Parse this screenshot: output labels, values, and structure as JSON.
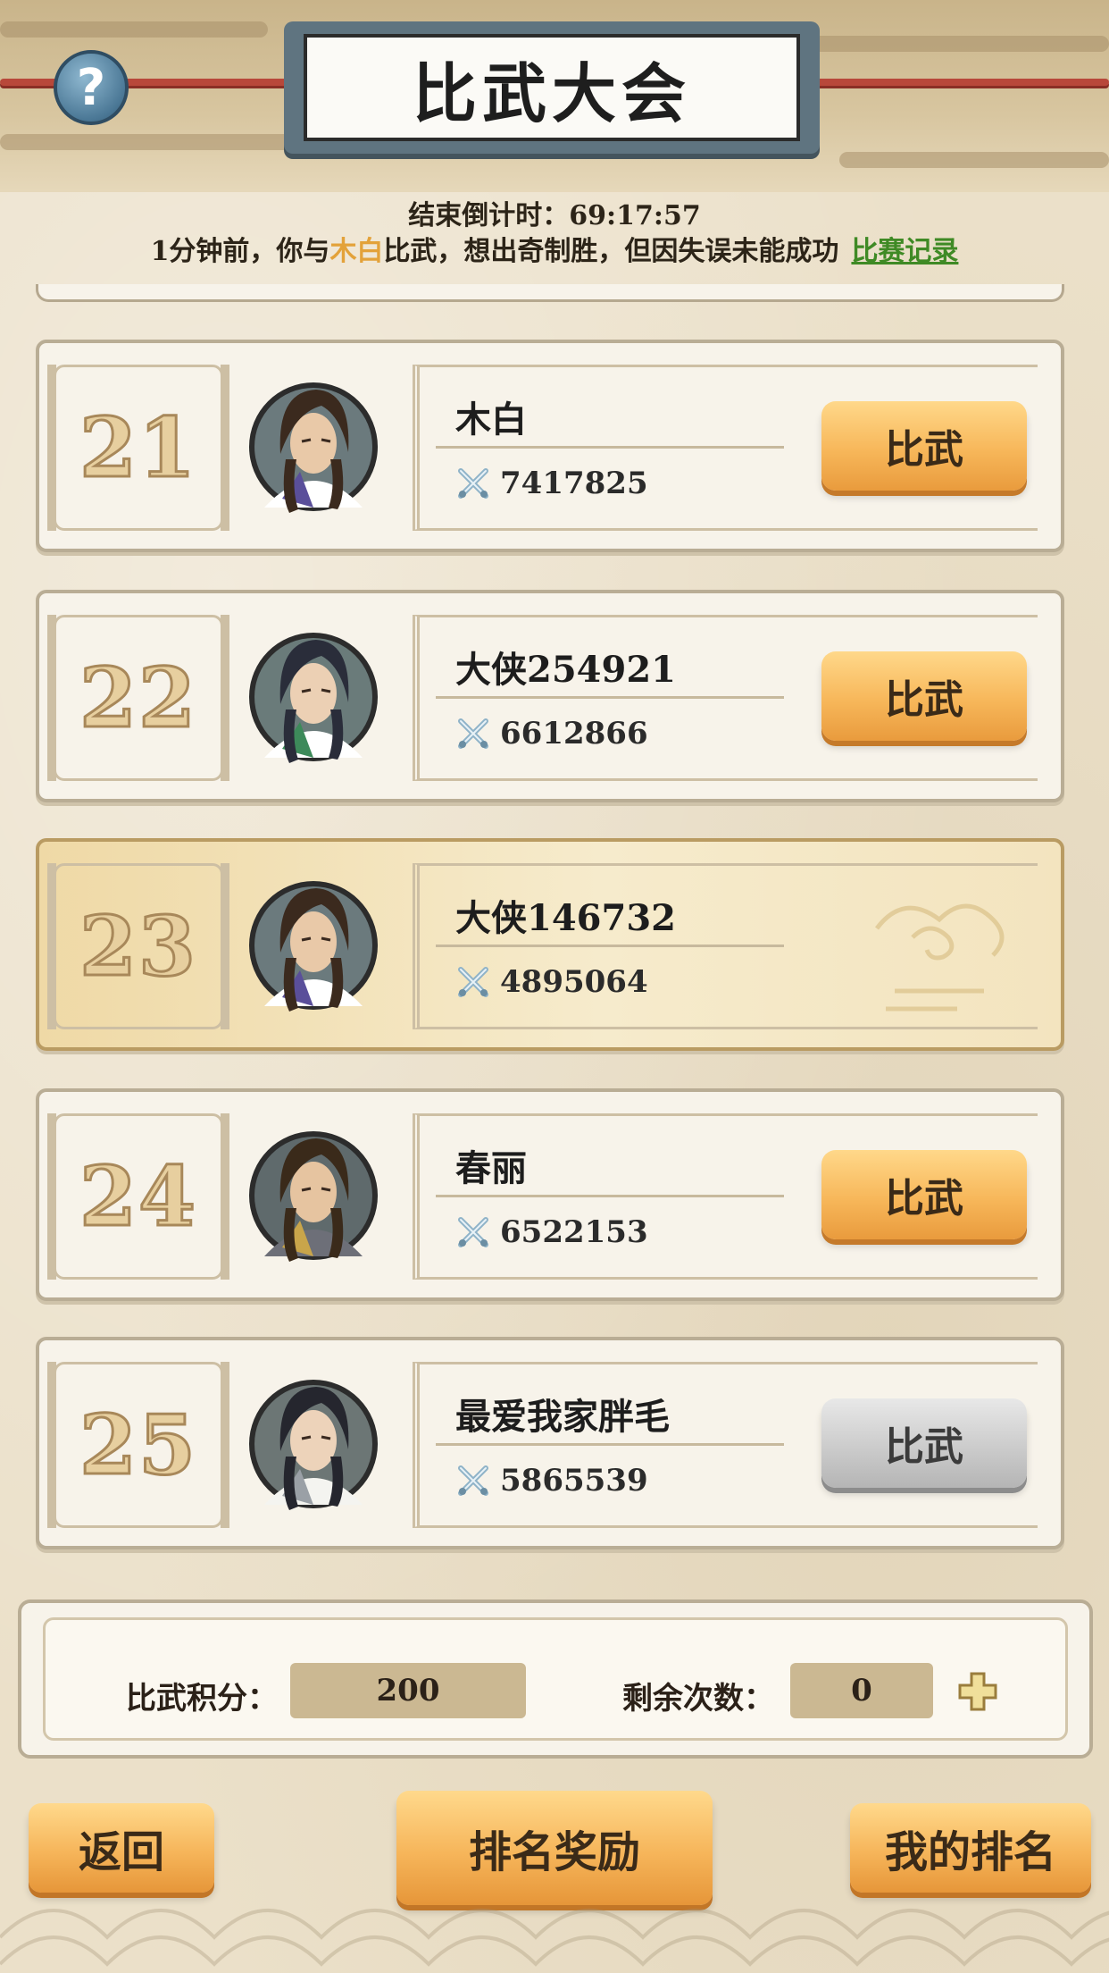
{
  "header": {
    "title": "比武大会",
    "help_label": "?"
  },
  "countdown": {
    "label": "结束倒计时：",
    "value": "69:17:57"
  },
  "news": {
    "prefix": "1分钟前，你与",
    "opponent": "木白",
    "suffix": "比武，想出奇制胜，但因失误未能成功",
    "record_link": "比赛记录"
  },
  "ranks": [
    {
      "rank": "21",
      "name": "木白",
      "power": "7417825",
      "button": "比武",
      "button_state": "active",
      "is_self": false
    },
    {
      "rank": "22",
      "name": "大侠254921",
      "power": "6612866",
      "button": "比武",
      "button_state": "active",
      "is_self": false
    },
    {
      "rank": "23",
      "name": "大侠146732",
      "power": "4895064",
      "button": "",
      "button_state": "none",
      "is_self": true
    },
    {
      "rank": "24",
      "name": "春丽",
      "power": "6522153",
      "button": "比武",
      "button_state": "active",
      "is_self": false
    },
    {
      "rank": "25",
      "name": "最爱我家胖毛",
      "power": "5865539",
      "button": "比武",
      "button_state": "disabled",
      "is_self": false
    }
  ],
  "stats": {
    "points_label": "比武积分：",
    "points_value": "200",
    "remaining_label": "剩余次数：",
    "remaining_value": "0"
  },
  "footer": {
    "back": "返回",
    "rewards": "排名奖励",
    "my_rank": "我的排名"
  },
  "colors": {
    "accent_orange": "#f7b75a",
    "link_green": "#3f8a25",
    "opponent_highlight": "#e3a23a",
    "disabled_gray": "#c9c9c9"
  }
}
